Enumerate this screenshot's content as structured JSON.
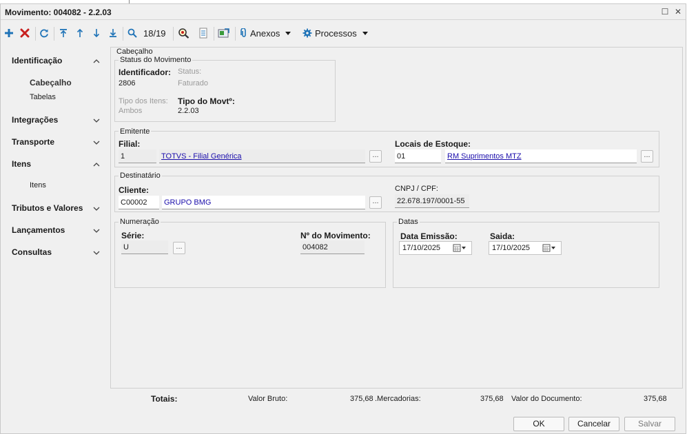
{
  "window": {
    "title": "Movimento: 004082 - 2.2.03"
  },
  "toolbar": {
    "record_position": "18/19",
    "anexos_label": "Anexos",
    "processos_label": "Processos"
  },
  "sidebar": {
    "sections": [
      {
        "label": "Identificação",
        "expanded": true,
        "items": [
          "Cabeçalho",
          "Tabelas"
        ],
        "active_item": "Cabeçalho"
      },
      {
        "label": "Integrações",
        "expanded": false
      },
      {
        "label": "Transporte",
        "expanded": false
      },
      {
        "label": "Itens",
        "expanded": true,
        "items": [
          "Itens"
        ]
      },
      {
        "label": "Tributos e Valores",
        "expanded": false
      },
      {
        "label": "Lançamentos",
        "expanded": false
      },
      {
        "label": "Consultas",
        "expanded": false
      }
    ]
  },
  "form": {
    "section_title": "Cabeçalho",
    "status": {
      "legend": "Status do Movimento",
      "identificador_label": "Identificador:",
      "identificador_value": "2806",
      "status_label": "Status:",
      "status_value": "Faturado",
      "tipo_itens_label": "Tipo dos Itens:",
      "tipo_itens_value": "Ambos",
      "tipo_movto_label": "Tipo do Movtº:",
      "tipo_movto_value": "2.2.03"
    },
    "emitente": {
      "legend": "Emitente",
      "filial_label": "Filial:",
      "filial_code": "1",
      "filial_name": "TOTVS - Filial Genérica",
      "locais_label": "Locais de Estoque:",
      "locais_code": "01",
      "locais_name": "RM Suprimentos MTZ",
      "lookup_label": "..."
    },
    "destinatario": {
      "legend": "Destinatário",
      "cliente_label": "Cliente:",
      "cliente_code": "C00002",
      "cliente_name": "GRUPO BMG",
      "cnpj_label": "CNPJ / CPF:",
      "cnpj_value": "22.678.197/0001-55",
      "lookup_label": "..."
    },
    "numeracao": {
      "legend": "Numeração",
      "serie_label": "Série:",
      "serie_value": "U",
      "numero_label": "Nº do Movimento:",
      "numero_value": "004082",
      "lookup_label": "..."
    },
    "datas": {
      "legend": "Datas",
      "emissao_label": "Data Emissão:",
      "emissao_value": "17/10/2025",
      "saida_label": "Saida:",
      "saida_value": "17/10/2025"
    }
  },
  "totals": {
    "label": "Totais:",
    "valor_bruto_label": "Valor Bruto:",
    "valor_bruto_value": "375,68",
    "mercadorias_label": ".Mercadorias:",
    "mercadorias_value": "375,68",
    "documento_label": "Valor do Documento:",
    "documento_value": "375,68"
  },
  "buttons": {
    "ok": "OK",
    "cancel": "Cancelar",
    "save": "Salvar"
  },
  "colors": {
    "add": "#1f73b7",
    "delete": "#c8201f",
    "nav": "#1f73b7",
    "link": "#1a0dab"
  }
}
